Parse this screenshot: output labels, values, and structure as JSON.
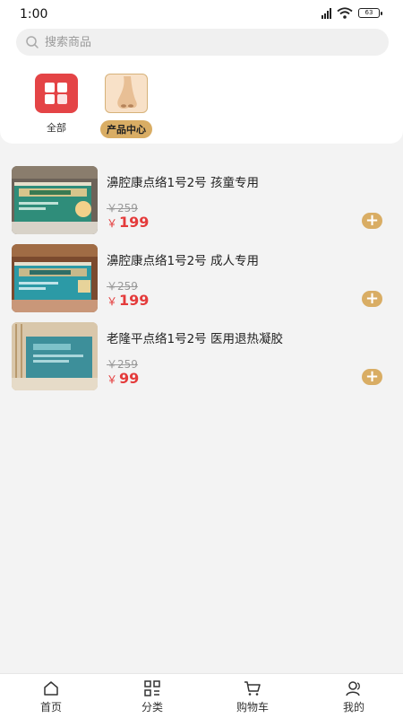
{
  "status": {
    "time": "1:00",
    "battery": "63"
  },
  "search": {
    "placeholder": "搜索商品"
  },
  "categories": [
    {
      "label": "全部",
      "active": false,
      "icon": "grid-icon"
    },
    {
      "label": "产品中心",
      "active": true,
      "icon": "nose-icon"
    }
  ],
  "products": [
    {
      "name": "濞腔康点络1号2号 孩童专用",
      "old_price": "￥259",
      "currency": "￥",
      "price": "199",
      "image": "product-box-teal-kids"
    },
    {
      "name": "濞腔康点络1号2号 成人专用",
      "old_price": "￥259",
      "currency": "￥",
      "price": "199",
      "image": "product-box-blue-adult"
    },
    {
      "name": "老隆平点络1号2号 医用退热凝胶",
      "old_price": "￥259",
      "currency": "￥",
      "price": "99",
      "image": "product-box-gel"
    }
  ],
  "tabbar": [
    {
      "label": "首页",
      "icon": "home-icon"
    },
    {
      "label": "分类",
      "icon": "category-icon"
    },
    {
      "label": "购物车",
      "icon": "cart-icon"
    },
    {
      "label": "我的",
      "icon": "user-icon"
    }
  ],
  "colors": {
    "accent": "#d9ad64",
    "price": "#e43b3b",
    "grid_red": "#e44446"
  }
}
